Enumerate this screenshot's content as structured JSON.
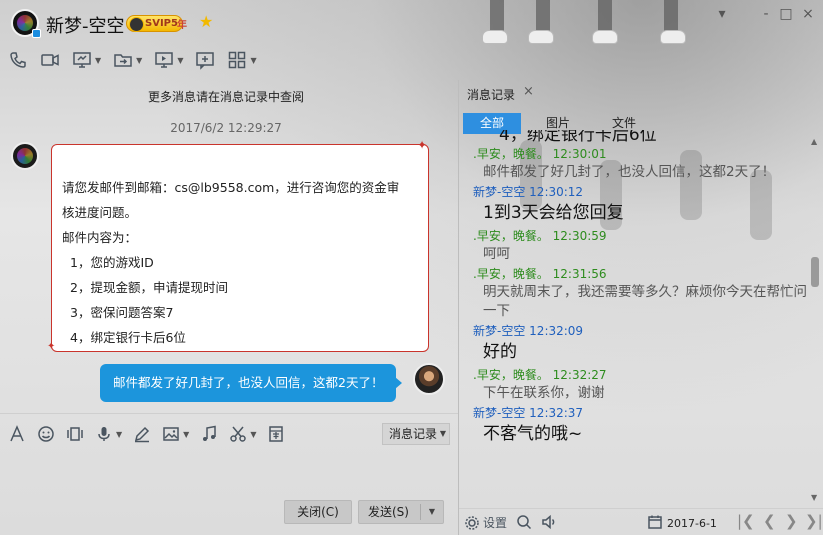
{
  "window": {
    "contact_name": "新梦-空空",
    "vip_label": "SVIP5",
    "year_label": "年",
    "controls": [
      "-",
      "□",
      "×"
    ]
  },
  "toolbar": {
    "items": [
      "phone-icon",
      "video-icon",
      "screen-share-icon",
      "file-transfer-icon",
      "remote-desktop-icon",
      "message-icon",
      "apps-icon"
    ]
  },
  "chat": {
    "more_history_text": "更多消息请在消息记录中查阅",
    "timestamp": "2017/6/2 12:29:27",
    "received_message": {
      "lines": [
        "请您发邮件到邮箱：cs@lb9558.com，进行咨询您的资金审",
        "核进度问题。",
        "邮件内容为：",
        "1，您的游戏ID",
        "2，提现金额，申请提现时间",
        "3，密保问题答案7",
        "4，绑定银行卡后6位"
      ]
    },
    "sent_message": "邮件都发了好几封了，也没人回信，这都2天了！"
  },
  "input_toolbar": {
    "items": [
      "font-icon",
      "emoji-icon",
      "screenshot-icon",
      "voice-icon",
      "handwrite-icon",
      "image-icon",
      "music-icon",
      "scissors-icon",
      "red-packet-icon"
    ],
    "history_button_label": "消息记录"
  },
  "actions": {
    "close_label": "关闭(C)",
    "send_label": "发送(S)"
  },
  "history_panel": {
    "tab_label": "消息记录",
    "filters": [
      "全部",
      "图片",
      "文件"
    ],
    "active_filter": "全部",
    "top_clipped_text": "4，绑定银行卡后6位",
    "messages": [
      {
        "sender": ".早安，晚餐。",
        "time": "12:30:01",
        "type": "other",
        "text": "邮件都发了好几封了，也没人回信，这都2天了！"
      },
      {
        "sender": "新梦-空空",
        "time": "12:30:12",
        "type": "self",
        "text": "1到3天会给您回复"
      },
      {
        "sender": ".早安，晚餐。",
        "time": "12:30:59",
        "type": "other",
        "text": "呵呵"
      },
      {
        "sender": ".早安，晚餐。",
        "time": "12:31:56",
        "type": "other",
        "text": "明天就周末了，我还需要等多久？麻烦你今天在帮忙问一下"
      },
      {
        "sender": "新梦-空空",
        "time": "12:32:09",
        "type": "self",
        "text": "好的"
      },
      {
        "sender": ".早安，晚餐。",
        "time": "12:32:27",
        "type": "other",
        "text": "下午在联系你，谢谢"
      },
      {
        "sender": "新梦-空空",
        "time": "12:32:37",
        "type": "self",
        "text": "不客气的哦~"
      }
    ],
    "footer": {
      "settings_label": "设置",
      "date": "2017-6-1"
    }
  }
}
